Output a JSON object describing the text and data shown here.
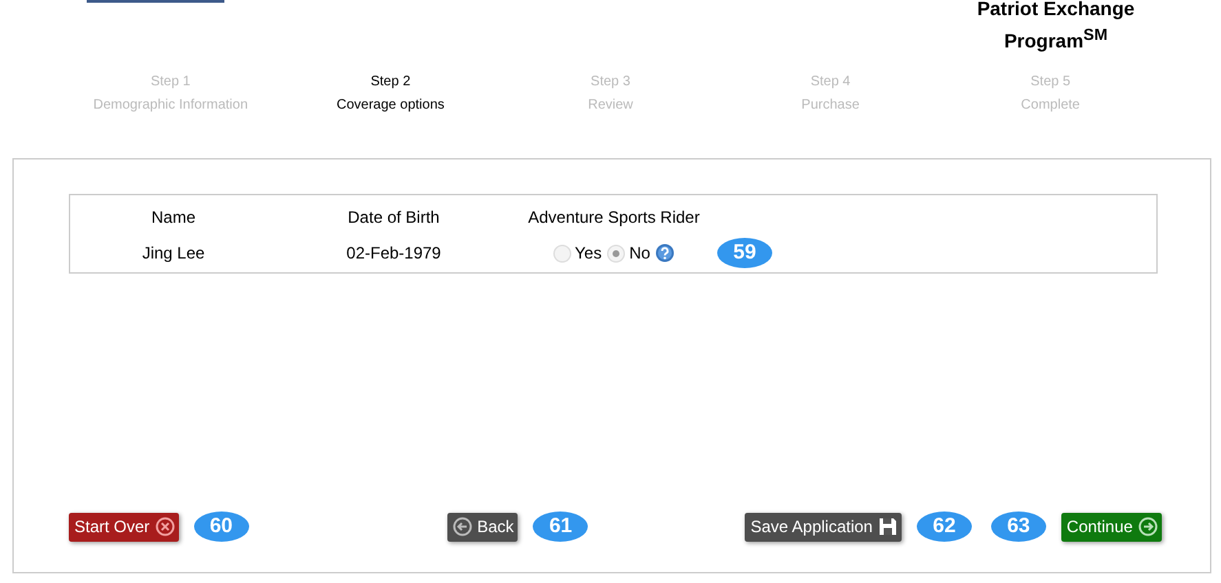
{
  "header": {
    "title": "Patriot Exchange Program$^{SM}$"
  },
  "steps": [
    {
      "number": "Step 1",
      "label": "Demographic Information",
      "selected": false
    },
    {
      "number": "Step 2",
      "label": "Coverage options",
      "selected": true
    },
    {
      "number": "Step 3",
      "label": "Review",
      "selected": false
    },
    {
      "number": "Step 4",
      "label": "Purchase",
      "selected": false
    },
    {
      "number": "Step 5",
      "label": "Complete",
      "selected": false
    }
  ],
  "table": {
    "columns": [
      "Name",
      "Date of Birth",
      "Adventure Sports Rider"
    ],
    "rows": [
      {
        "name": "Jing Lee",
        "dob": "02-Feb-1979",
        "options": [
          {
            "label": "Yes",
            "selected": false,
            "disabled": true
          },
          {
            "label": "No",
            "selected": true,
            "disabled": true
          }
        ],
        "badge": "59"
      }
    ]
  },
  "buttons": [
    {
      "label": "Start Over",
      "kind": "startover",
      "badge": "60"
    },
    {
      "label": "Back",
      "kind": "back",
      "badge": "61"
    },
    {
      "label": "Save Application",
      "kind": "save",
      "badge": "62"
    },
    {
      "label": "Continue",
      "kind": "continue",
      "badge": "63"
    }
  ]
}
